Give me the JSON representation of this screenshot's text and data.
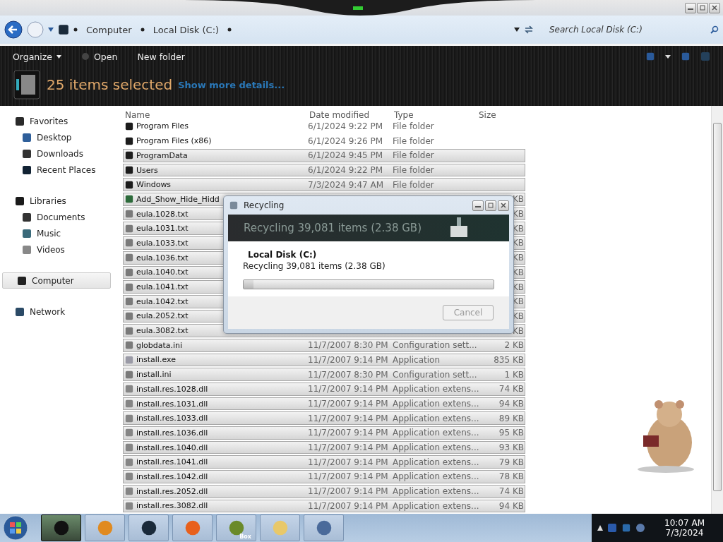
{
  "address_bar": {
    "breadcrumbs": [
      "Computer",
      "Local Disk (C:)"
    ],
    "search": {
      "placeholder": "Search Local Disk (C:)"
    }
  },
  "toolbar": {
    "buttons": [
      {
        "label": "Organize",
        "kind": "menu"
      },
      {
        "label": "Open",
        "kind": "icon"
      },
      {
        "label": "New folder",
        "kind": "plain"
      }
    ]
  },
  "details": {
    "summary": "25 items selected",
    "link": "Show more details..."
  },
  "sidebar": {
    "items": [
      {
        "label": "Favorites",
        "kind": "star",
        "selected": false,
        "children": [
          {
            "label": "Desktop",
            "kind": "desktop",
            "selected": false
          },
          {
            "label": "Downloads",
            "kind": "download",
            "selected": false
          },
          {
            "label": "Recent Places",
            "kind": "recent",
            "selected": false
          }
        ]
      },
      {
        "label": "Libraries",
        "kind": "library",
        "selected": false,
        "children": [
          {
            "label": "Documents",
            "kind": "document",
            "selected": false
          },
          {
            "label": "Music",
            "kind": "music",
            "selected": false
          },
          {
            "label": "Videos",
            "kind": "video",
            "selected": false
          }
        ]
      },
      {
        "label": "Computer",
        "kind": "computer",
        "selected": true
      },
      {
        "label": "Network",
        "kind": "network",
        "selected": false
      }
    ]
  },
  "table": {
    "columns": [
      "Name",
      "Date modified",
      "Type",
      "Size"
    ],
    "rows": [
      {
        "kind": "folder",
        "name": "Program Files",
        "date": "6/1/2024 9:22 PM",
        "type": "File folder",
        "selected": false
      },
      {
        "kind": "folder",
        "name": "Program Files (x86)",
        "date": "6/1/2024 9:26 PM",
        "type": "File folder",
        "selected": false
      },
      {
        "kind": "folder",
        "name": "ProgramData",
        "date": "6/1/2024 9:45 PM",
        "type": "File folder",
        "selected": true
      },
      {
        "kind": "folder",
        "name": "Users",
        "date": "6/1/2024 9:22 PM",
        "type": "File folder",
        "selected": true
      },
      {
        "kind": "folder",
        "name": "Windows",
        "date": "7/3/2024 9:47 AM",
        "type": "File folder",
        "selected": true
      },
      {
        "kind": "script",
        "name": "Add_Show_Hide_Hidd",
        "size": "KB",
        "selected": true
      },
      {
        "kind": "text",
        "name": "eula.1028.txt",
        "size": "KB",
        "selected": true
      },
      {
        "kind": "text",
        "name": "eula.1031.txt",
        "size": "KB",
        "selected": true
      },
      {
        "kind": "text",
        "name": "eula.1033.txt",
        "size": "KB",
        "selected": true
      },
      {
        "kind": "text",
        "name": "eula.1036.txt",
        "size": "KB",
        "selected": true
      },
      {
        "kind": "text",
        "name": "eula.1040.txt",
        "size": "KB",
        "selected": true
      },
      {
        "kind": "text",
        "name": "eula.1041.txt",
        "size": "KB",
        "selected": true
      },
      {
        "kind": "text",
        "name": "eula.1042.txt",
        "size": "KB",
        "selected": true
      },
      {
        "kind": "text",
        "name": "eula.2052.txt",
        "size": "KB",
        "selected": true
      },
      {
        "kind": "text",
        "name": "eula.3082.txt",
        "size": "KB",
        "selected": true
      },
      {
        "kind": "text",
        "name": "globdata.ini",
        "date": "11/7/2007 8:30 PM",
        "type": "Configuration sett...",
        "size": "2 KB",
        "selected": true
      },
      {
        "kind": "exe",
        "name": "install.exe",
        "date": "11/7/2007 9:14 PM",
        "type": "Application",
        "size": "835 KB",
        "selected": true
      },
      {
        "kind": "text",
        "name": "install.ini",
        "date": "11/7/2007 8:30 PM",
        "type": "Configuration sett...",
        "size": "1 KB",
        "selected": true
      },
      {
        "kind": "dll",
        "name": "install.res.1028.dll",
        "date": "11/7/2007 9:14 PM",
        "type": "Application extens...",
        "size": "74 KB",
        "selected": true
      },
      {
        "kind": "dll",
        "name": "install.res.1031.dll",
        "date": "11/7/2007 9:14 PM",
        "type": "Application extens...",
        "size": "94 KB",
        "selected": true
      },
      {
        "kind": "dll",
        "name": "install.res.1033.dll",
        "date": "11/7/2007 9:14 PM",
        "type": "Application extens...",
        "size": "89 KB",
        "selected": true
      },
      {
        "kind": "dll",
        "name": "install.res.1036.dll",
        "date": "11/7/2007 9:14 PM",
        "type": "Application extens...",
        "size": "95 KB",
        "selected": true
      },
      {
        "kind": "dll",
        "name": "install.res.1040.dll",
        "date": "11/7/2007 9:14 PM",
        "type": "Application extens...",
        "size": "93 KB",
        "selected": true
      },
      {
        "kind": "dll",
        "name": "install.res.1041.dll",
        "date": "11/7/2007 9:14 PM",
        "type": "Application extens...",
        "size": "79 KB",
        "selected": true
      },
      {
        "kind": "dll",
        "name": "install.res.1042.dll",
        "date": "11/7/2007 9:14 PM",
        "type": "Application extens...",
        "size": "78 KB",
        "selected": true
      },
      {
        "kind": "dll",
        "name": "install.res.2052.dll",
        "date": "11/7/2007 9:14 PM",
        "type": "Application extens...",
        "size": "74 KB",
        "selected": true
      },
      {
        "kind": "dll",
        "name": "install.res.3082.dll",
        "date": "11/7/2007 9:14 PM",
        "type": "Application extens...",
        "size": "94 KB",
        "selected": true
      }
    ]
  },
  "dialog": {
    "title": "Recycling",
    "banner": "Recycling 39,081 items (2.38 GB)",
    "location": "Local Disk (C:)",
    "status": "Recycling 39,081 items (2.38 GB)",
    "progress": {
      "level": 0.04
    },
    "button": {
      "label": "Cancel",
      "disabled": true
    }
  },
  "taskbar": {
    "items": [
      {
        "kind": "explorer",
        "selected": true
      },
      {
        "kind": "media",
        "selected": false
      },
      {
        "kind": "globe",
        "selected": false
      },
      {
        "kind": "firefox",
        "selected": false
      },
      {
        "kind": "box",
        "label": "Box",
        "selected": false
      },
      {
        "kind": "folder",
        "selected": false
      },
      {
        "kind": "network",
        "selected": false
      }
    ],
    "clock": {
      "time": "10:07 AM",
      "date": "7/3/2024"
    }
  }
}
